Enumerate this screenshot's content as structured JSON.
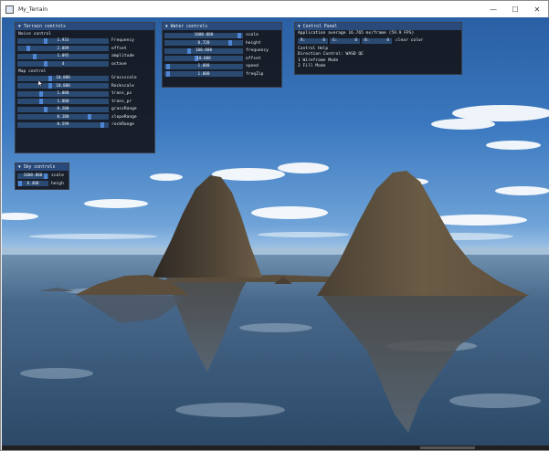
{
  "window": {
    "title": "My_Terrain",
    "minimize_glyph": "—",
    "maximize_glyph": "☐",
    "close_glyph": "✕"
  },
  "terrain_panel": {
    "title": "Terrain controls",
    "noise_section": "Noise control",
    "noise_sliders": [
      {
        "value": "1.933",
        "label": "Frequency",
        "fill": 0.3
      },
      {
        "value": "2.089",
        "label": "offset",
        "fill": 0.1
      },
      {
        "value": "1.095",
        "label": "amplitude",
        "fill": 0.18
      },
      {
        "value": "4",
        "label": "octave",
        "fill": 0.3
      }
    ],
    "map_section": "Map control",
    "map_sliders": [
      {
        "value": "10.000",
        "label": "Grassscale",
        "fill": 0.35
      },
      {
        "value": "10.000",
        "label": "Rockscale",
        "fill": 0.35
      },
      {
        "value": "1.000",
        "label": "trans_px",
        "fill": 0.25
      },
      {
        "value": "1.000",
        "label": "trans_pr",
        "fill": 0.25
      },
      {
        "value": "0.200",
        "label": "grassRange",
        "fill": 0.3
      },
      {
        "value": "0.180",
        "label": "slopeRange",
        "fill": 0.8
      },
      {
        "value": "0.599",
        "label": "rockRange",
        "fill": 0.95
      }
    ]
  },
  "water_panel": {
    "title": "Water controls",
    "sliders": [
      {
        "value": "1000.000",
        "label": "scale",
        "fill": 0.97
      },
      {
        "value": "0.720",
        "label": "height",
        "fill": 0.85
      },
      {
        "value": "100.000",
        "label": "frequency",
        "fill": 0.3
      },
      {
        "value": "10.000",
        "label": "offset",
        "fill": 0.4
      },
      {
        "value": "1.000",
        "label": "speed",
        "fill": 0.03
      },
      {
        "value": "1.000",
        "label": "freqZip",
        "fill": 0.03
      }
    ]
  },
  "control_panel": {
    "title": "Control Panel",
    "perf": "Application average 16.765 ms/frame (59.9 FPS)",
    "clear_channels": [
      {
        "name": "R:",
        "value": "0"
      },
      {
        "name": "G:",
        "value": "0"
      },
      {
        "name": "B:",
        "value": "0"
      }
    ],
    "clear_label": "clear color",
    "help_lines": [
      "Control Help",
      "Direction Control: WASD QE",
      "1 Wireframe Mode",
      "2 Fill Mode"
    ]
  },
  "sky_panel": {
    "title": "Sky controls",
    "sliders": [
      {
        "value": "1000.000",
        "label": "scale",
        "fill": 0.97
      },
      {
        "value": "0.400",
        "label": "heigh",
        "fill": 0.04
      }
    ]
  },
  "colors": {
    "panel_bg": "#16181e",
    "title_bar": "#294a7a",
    "slider_bg": "#2a4a72",
    "slider_grab": "#4f86d4",
    "sky_top": "#2a5fa3",
    "water": "#3f5f80",
    "rock": "#4a3f33"
  }
}
